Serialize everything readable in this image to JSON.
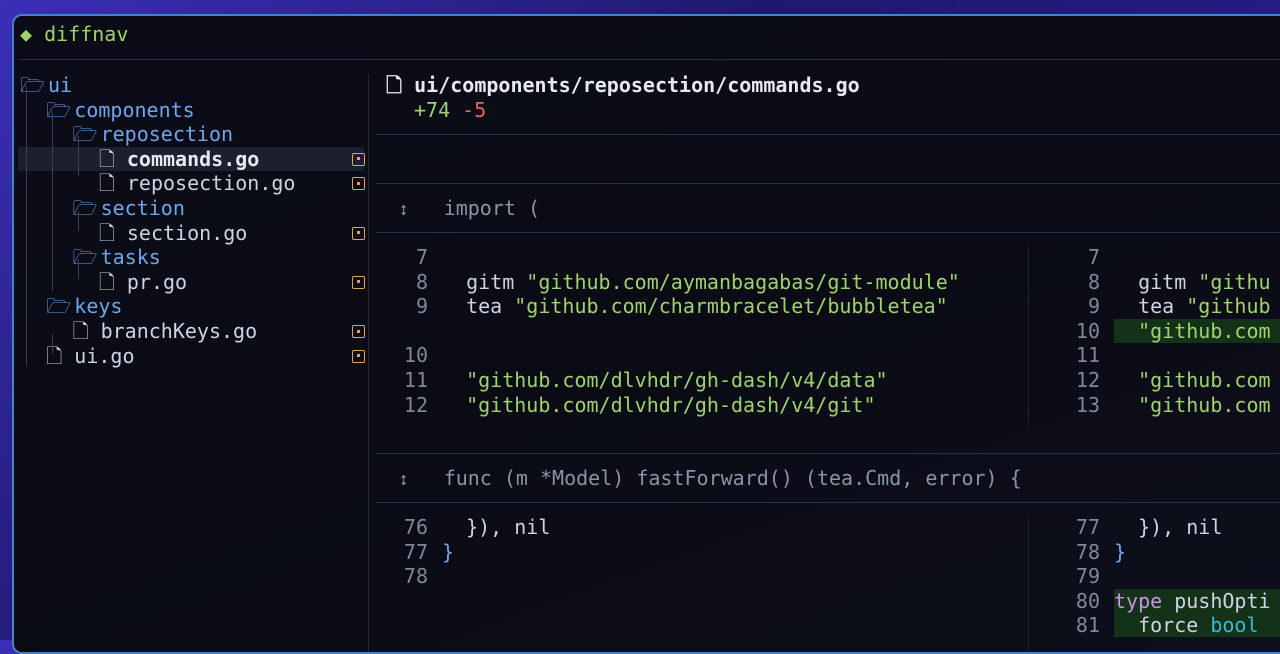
{
  "app": {
    "title": "diffnav"
  },
  "tree": [
    {
      "label": "ui",
      "type": "folder",
      "depth": 0
    },
    {
      "label": "components",
      "type": "folder",
      "depth": 1
    },
    {
      "label": "reposection",
      "type": "folder",
      "depth": 2
    },
    {
      "label": "commands.go",
      "type": "file",
      "depth": 3,
      "selected": true,
      "status": "modified"
    },
    {
      "label": "reposection.go",
      "type": "file",
      "depth": 3,
      "status": "modified"
    },
    {
      "label": "section",
      "type": "folder",
      "depth": 2
    },
    {
      "label": "section.go",
      "type": "file",
      "depth": 3,
      "status": "modified"
    },
    {
      "label": "tasks",
      "type": "folder",
      "depth": 2
    },
    {
      "label": "pr.go",
      "type": "file",
      "depth": 3,
      "status": "modified"
    },
    {
      "label": "keys",
      "type": "folder",
      "depth": 1
    },
    {
      "label": "branchKeys.go",
      "type": "file",
      "depth": 2,
      "status": "modified"
    },
    {
      "label": "ui.go",
      "type": "file",
      "depth": 1,
      "status": "modified"
    }
  ],
  "diff": {
    "path": "ui/components/reposection/commands.go",
    "additions": "+74",
    "deletions": "-5",
    "hunks": [
      {
        "header": "import (",
        "left": [
          [
            "7",
            ""
          ],
          [
            "8",
            "  gitm \"github.com/aymanbagabas/git-module\""
          ],
          [
            "9",
            "  tea \"github.com/charmbracelet/bubbletea\""
          ],
          [
            "",
            ""
          ],
          [
            "10",
            ""
          ],
          [
            "11",
            "  \"github.com/dlvhdr/gh-dash/v4/data\""
          ],
          [
            "12",
            "  \"github.com/dlvhdr/gh-dash/v4/git\""
          ]
        ],
        "right": [
          [
            "7",
            ""
          ],
          [
            "8",
            "  gitm \"githu"
          ],
          [
            "9",
            "  tea \"github"
          ],
          [
            "10",
            "  \"github.com"
          ],
          [
            "11",
            ""
          ],
          [
            "12",
            "  \"github.com"
          ],
          [
            "13",
            "  \"github.com"
          ]
        ]
      },
      {
        "header": "func (m *Model) fastForward() (tea.Cmd, error) {",
        "left": [
          [
            "76",
            "  }), nil"
          ],
          [
            "77",
            "}"
          ],
          [
            "78",
            ""
          ]
        ],
        "right": [
          [
            "77",
            "  }), nil"
          ],
          [
            "78",
            "}"
          ],
          [
            "79",
            ""
          ],
          [
            "80",
            "type pushOpti"
          ],
          [
            "81",
            "  force bool"
          ]
        ]
      }
    ]
  },
  "colors": {
    "accent": "#9fd26c",
    "folder": "#6ea6ee",
    "added": "#9fd26c",
    "deleted": "#f0616e",
    "modified": "#e0a35c"
  }
}
